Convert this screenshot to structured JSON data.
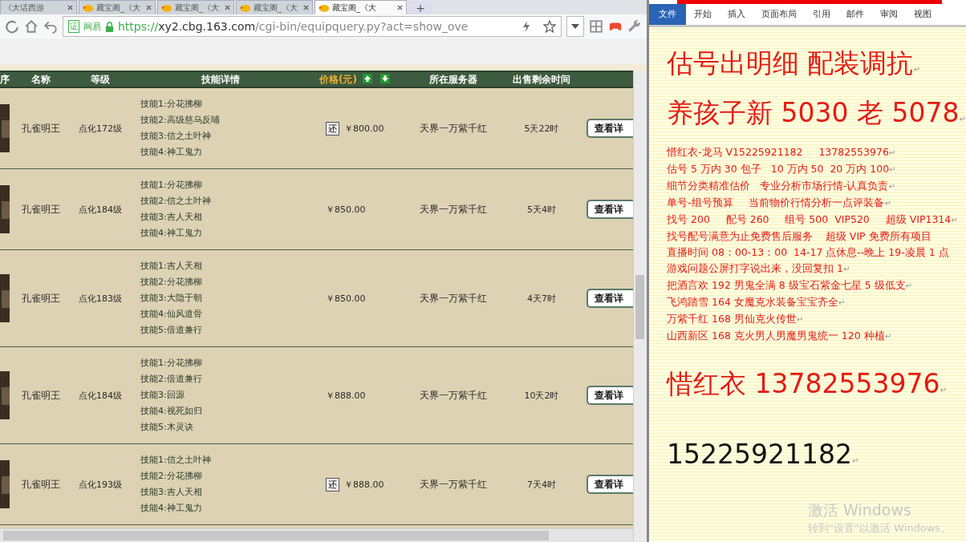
{
  "browser": {
    "tabs": [
      {
        "title": "《大话西游",
        "selected": false
      },
      {
        "title": "藏宝阁_《大",
        "selected": false
      },
      {
        "title": "藏宝阁_《大",
        "selected": false
      },
      {
        "title": "藏宝阁_《大",
        "selected": false
      },
      {
        "title": "藏宝阁_《大",
        "selected": true
      }
    ],
    "new_tab": "+",
    "address": {
      "badge": "证",
      "site": "网易",
      "scheme": "https://",
      "host": "xy2.cbg.163.com",
      "path": "/cgi-bin/equipquery.py?act=show_ove"
    }
  },
  "table": {
    "columns": [
      "序",
      "名称",
      "等级",
      "技能详情",
      "价格(元)",
      "所在服务器",
      "出售剩余时间"
    ],
    "rows": [
      {
        "name": "孔雀明王",
        "level": "点化172级",
        "skills": [
          "技能1:分花拂柳",
          "技能2:高级慈乌反哺",
          "技能3:信之土叶神",
          "技能4:神工鬼力"
        ],
        "tag": "还",
        "price": "￥800.00",
        "server": "天界一万紫千红",
        "remaining": "5天22时",
        "action": "查看详"
      },
      {
        "name": "孔雀明王",
        "level": "点化184级",
        "skills": [
          "技能1:分花拂柳",
          "技能2:信之土叶神",
          "技能3:吉人天相",
          "技能4:神工鬼力"
        ],
        "price": "￥850.00",
        "server": "天界一万紫千红",
        "remaining": "5天4时",
        "action": "查看详"
      },
      {
        "name": "孔雀明王",
        "level": "点化183级",
        "skills": [
          "技能1:吉人天相",
          "技能2:分花拂柳",
          "技能3:大隐于朝",
          "技能4:仙风道骨",
          "技能5:倍道兼行"
        ],
        "price": "￥850.00",
        "server": "天界一万紫千红",
        "remaining": "4天7时",
        "action": "查看详"
      },
      {
        "name": "孔雀明王",
        "level": "点化184级",
        "skills": [
          "技能1:分花拂柳",
          "技能2:倍道兼行",
          "技能3:回源",
          "技能4:视死如归",
          "技能5:木灵诀"
        ],
        "price": "￥888.00",
        "server": "天界一万紫千红",
        "remaining": "10天2时",
        "action": "查看详"
      },
      {
        "name": "孔雀明王",
        "level": "点化193级",
        "skills": [
          "技能1:信之土叶神",
          "技能2:分花拂柳",
          "技能3:吉人天相",
          "技能4:神工鬼力"
        ],
        "tag": "还",
        "price": "￥888.00",
        "server": "天界一万紫千红",
        "remaining": "7天4时",
        "action": "查看详"
      }
    ]
  },
  "word": {
    "ribbon_tabs": [
      {
        "label": "文件",
        "selected": true
      },
      {
        "label": "开始",
        "selected": false
      },
      {
        "label": "插入",
        "selected": false
      },
      {
        "label": "页面布局",
        "selected": false
      },
      {
        "label": "引用",
        "selected": false
      },
      {
        "label": "邮件",
        "selected": false
      },
      {
        "label": "审阅",
        "selected": false
      },
      {
        "label": "视图",
        "selected": false
      }
    ],
    "paragraphs": [
      {
        "kind": "heading",
        "text": "估号出明细 配装调抗",
        "end_mark": "↵"
      },
      {
        "kind": "heading",
        "text": "养孩子新 5030 老 5078",
        "end_mark": "↵"
      },
      {
        "kind": "body",
        "text": "惜红衣-龙马 V15225921182     13782553976",
        "end_mark": "↵"
      },
      {
        "kind": "body",
        "text": "估号 5 万内 30 包子   10 万内 50  20 万内 100",
        "end_mark": "↵"
      },
      {
        "kind": "body",
        "text": "细节分类精准估价   专业分析市场行情-认真负责",
        "end_mark": "↵"
      },
      {
        "kind": "body",
        "text": "单号-组号预算     当前物价行情分析一点评装备",
        "end_mark": "↵"
      },
      {
        "kind": "body",
        "text": "找号 200     配号 260     组号 500  VIP520     超级 VIP1314",
        "end_mark": "↵"
      },
      {
        "kind": "body",
        "text": "找号配号满意为止免费售后服务    超级 VIP 免费所有项目"
      },
      {
        "kind": "body",
        "text": "直播时间 08：00-13：00  14-17 点休息--晚上 19-凌晨 1 点"
      },
      {
        "kind": "body",
        "text": "游戏问题公屏打字说出来，没回复扣 1",
        "end_mark": "↵"
      },
      {
        "kind": "body",
        "text": "把酒言欢 192 男鬼全满 8 级宝石紫金七星 5 级低支",
        "end_mark": "↵"
      },
      {
        "kind": "body",
        "text": "飞鸿踏雪 164 女魔克水装备宝宝齐全",
        "end_mark": "↵"
      },
      {
        "kind": "body",
        "text": "万紫千红 168 男仙克火传世",
        "end_mark": "↵"
      },
      {
        "kind": "body",
        "text": "山西新区 168 克火男人男魔男鬼统一 120 种植",
        "end_mark": "↵"
      },
      {
        "kind": "spacer"
      },
      {
        "kind": "heading",
        "text": "惜红衣 13782553976",
        "end_mark": "↵"
      },
      {
        "kind": "spacer"
      },
      {
        "kind": "black",
        "text": "15225921182",
        "end_mark": "↵"
      }
    ]
  },
  "activation_notice": [
    "激活 Windows",
    "转到\"设置\"以激活 Windows。"
  ]
}
